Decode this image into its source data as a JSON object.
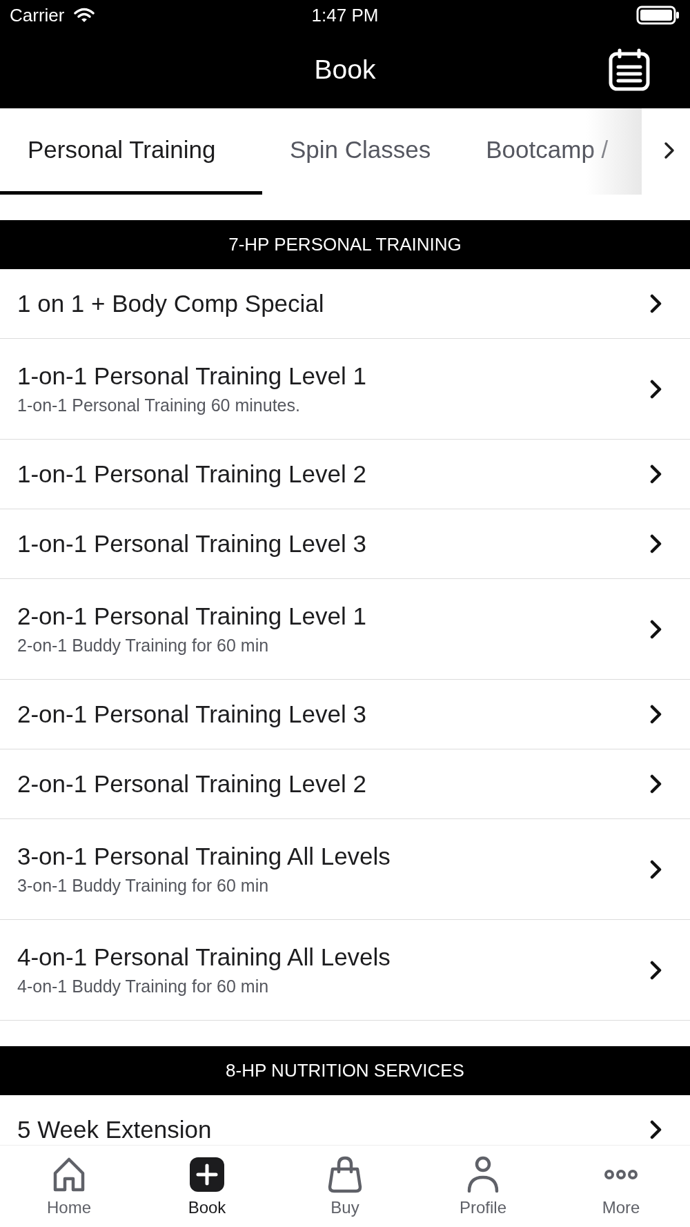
{
  "status_bar": {
    "carrier": "Carrier",
    "time": "1:47 PM"
  },
  "header": {
    "title": "Book"
  },
  "tabs": [
    {
      "label": "Personal Training",
      "selected": true
    },
    {
      "label": "Spin Classes",
      "selected": false
    },
    {
      "label": "Bootcamp /",
      "selected": false
    }
  ],
  "sections": [
    {
      "title": "7-HP PERSONAL TRAINING",
      "items": [
        {
          "title": "1 on 1 + Body Comp Special"
        },
        {
          "title": "1-on-1 Personal Training Level 1",
          "subtitle": "1-on-1 Personal Training 60  minutes."
        },
        {
          "title": "1-on-1 Personal Training Level 2"
        },
        {
          "title": "1-on-1 Personal Training Level 3"
        },
        {
          "title": "2-on-1 Personal Training Level 1",
          "subtitle": "2-on-1 Buddy Training for 60 min"
        },
        {
          "title": "2-on-1 Personal Training Level 3"
        },
        {
          "title": "2-on-1 Personal Training Level 2"
        },
        {
          "title": "3-on-1 Personal Training All Levels",
          "subtitle": "3-on-1 Buddy Training for 60 min"
        },
        {
          "title": "4-on-1 Personal Training All Levels",
          "subtitle": "4-on-1 Buddy Training for 60 min"
        }
      ]
    },
    {
      "title": "8-HP NUTRITION SERVICES",
      "items": [
        {
          "title": "5 Week Extension"
        }
      ]
    }
  ],
  "tab_bar": [
    {
      "label": "Home",
      "selected": false
    },
    {
      "label": "Book",
      "selected": true
    },
    {
      "label": "Buy",
      "selected": false
    },
    {
      "label": "Profile",
      "selected": false
    },
    {
      "label": "More",
      "selected": false
    }
  ]
}
